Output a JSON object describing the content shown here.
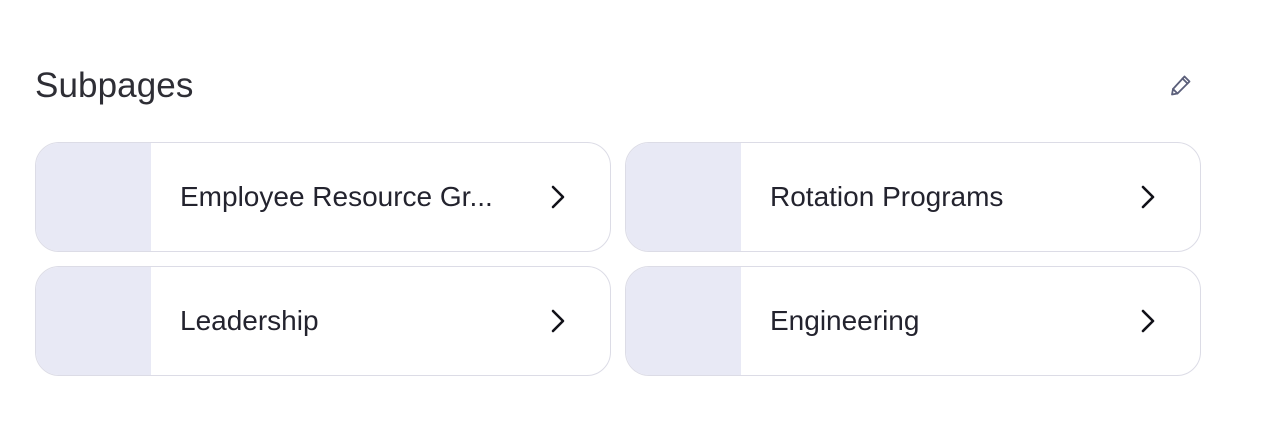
{
  "section": {
    "title": "Subpages",
    "edit_icon": "pencil-icon"
  },
  "subpages": [
    {
      "label": "Employee Resource Gr...",
      "icon": "chevron-right-icon"
    },
    {
      "label": "Rotation Programs",
      "icon": "chevron-right-icon"
    },
    {
      "label": "Leadership",
      "icon": "chevron-right-icon"
    },
    {
      "label": "Engineering",
      "icon": "chevron-right-icon"
    }
  ],
  "colors": {
    "thumbnail": "#e8e9f5",
    "border": "#dcdce6",
    "text": "#23232e",
    "icon": "#5b5f7a"
  }
}
